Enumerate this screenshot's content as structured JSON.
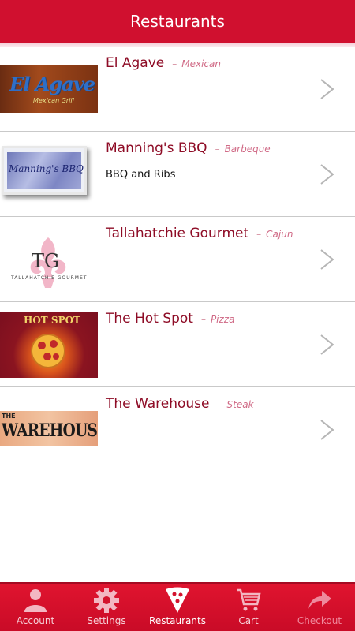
{
  "header": {
    "title": "Restaurants"
  },
  "restaurants": [
    {
      "name": "El Agave",
      "separator": "–",
      "cuisine": "Mexican",
      "subtitle": "",
      "logo_text": "El Agave",
      "logo_subtext": "Mexican Grill"
    },
    {
      "name": "Manning's BBQ",
      "separator": "–",
      "cuisine": "Barbeque",
      "subtitle": "BBQ and Ribs",
      "logo_text": "Manning's BBQ"
    },
    {
      "name": "Tallahatchie Gourmet",
      "separator": "–",
      "cuisine": "Cajun",
      "subtitle": "",
      "logo_text": "TG",
      "logo_subtext": "TALLAHATCHIE GOURMET"
    },
    {
      "name": "The Hot Spot",
      "separator": "–",
      "cuisine": "Pizza",
      "subtitle": "",
      "logo_text": "HOT SPOT"
    },
    {
      "name": "The Warehouse",
      "separator": "–",
      "cuisine": "Steak",
      "subtitle": "",
      "logo_text": "WAREHOUSE",
      "logo_subtext": "THE"
    }
  ],
  "tabs": [
    {
      "label": "Account",
      "icon": "person-icon",
      "state": "normal"
    },
    {
      "label": "Settings",
      "icon": "gear-icon",
      "state": "normal"
    },
    {
      "label": "Restaurants",
      "icon": "pizza-slice-icon",
      "state": "active"
    },
    {
      "label": "Cart",
      "icon": "cart-icon",
      "state": "normal"
    },
    {
      "label": "Checkout",
      "icon": "share-arrow-icon",
      "state": "disabled"
    }
  ],
  "colors": {
    "brand_red": "#d0102f",
    "name_text": "#8e0c26",
    "cuisine_text": "#d06a86"
  }
}
